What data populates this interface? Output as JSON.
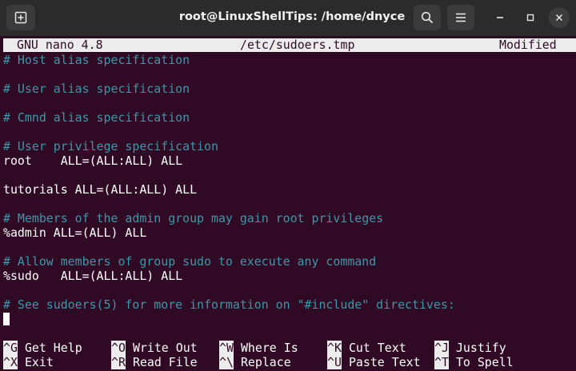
{
  "window": {
    "title": "root@LinuxShellTips: /home/dnyce"
  },
  "icons": {
    "new_tab": "new-tab-icon",
    "search": "search-icon",
    "menu": "hamburger-menu-icon",
    "minimize": "minimize-icon",
    "maximize": "maximize-icon",
    "close": "close-icon"
  },
  "colors": {
    "terminal_bg": "#300a24",
    "comment": "#3e97a8",
    "text": "#ffffff",
    "status_bg": "#ececec"
  },
  "nano": {
    "version": "GNU nano 4.8",
    "filename": "/etc/sudoers.tmp",
    "state": "Modified"
  },
  "buffer": {
    "lines": [
      {
        "text": "# Host alias specification",
        "kind": "comment"
      },
      {
        "text": "",
        "kind": "blank"
      },
      {
        "text": "# User alias specification",
        "kind": "comment"
      },
      {
        "text": "",
        "kind": "blank"
      },
      {
        "text": "# Cmnd alias specification",
        "kind": "comment"
      },
      {
        "text": "",
        "kind": "blank"
      },
      {
        "text": "# User privilege specification",
        "kind": "comment"
      },
      {
        "text": "root    ALL=(ALL:ALL) ALL",
        "kind": "code"
      },
      {
        "text": "",
        "kind": "blank"
      },
      {
        "text": "tutorials ALL=(ALL:ALL) ALL",
        "kind": "code"
      },
      {
        "text": "",
        "kind": "blank"
      },
      {
        "text": "# Members of the admin group may gain root privileges",
        "kind": "comment"
      },
      {
        "text": "%admin ALL=(ALL) ALL",
        "kind": "code"
      },
      {
        "text": "",
        "kind": "blank"
      },
      {
        "text": "# Allow members of group sudo to execute any command",
        "kind": "comment"
      },
      {
        "text": "%sudo   ALL=(ALL:ALL) ALL",
        "kind": "code"
      },
      {
        "text": "",
        "kind": "blank"
      },
      {
        "text": "# See sudoers(5) for more information on \"#include\" directives:",
        "kind": "comment"
      }
    ]
  },
  "shortcuts": [
    {
      "key": "^G",
      "label": "Get Help"
    },
    {
      "key": "^O",
      "label": "Write Out"
    },
    {
      "key": "^W",
      "label": "Where Is"
    },
    {
      "key": "^K",
      "label": "Cut Text"
    },
    {
      "key": "^J",
      "label": "Justify"
    },
    {
      "key": "^X",
      "label": "Exit"
    },
    {
      "key": "^R",
      "label": "Read File"
    },
    {
      "key": "^\\",
      "label": "Replace"
    },
    {
      "key": "^U",
      "label": "Paste Text"
    },
    {
      "key": "^T",
      "label": "To Spell"
    }
  ]
}
